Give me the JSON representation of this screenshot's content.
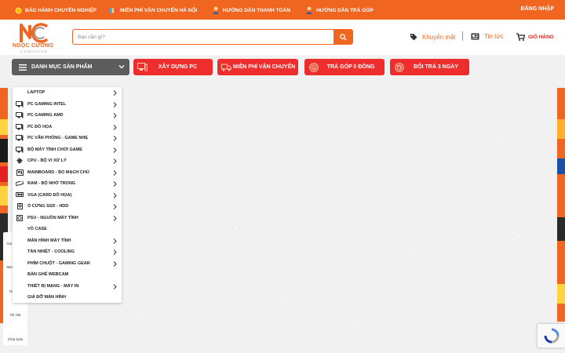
{
  "topbar": {
    "items": [
      {
        "label": "BẢO HÀNH CHUYÊN NGHIỆP",
        "icon": "coin-icon"
      },
      {
        "label": "MIỄN PHÍ VẬN CHUYỂN HÀ NỘI",
        "icon": "flag-icon"
      },
      {
        "label": "HƯỚNG DẪN THANH TOÁN",
        "icon": "user-guide-icon"
      },
      {
        "label": "HƯỚNG DẪN TRẢ GÓP",
        "icon": "user-guide-icon"
      }
    ],
    "login_label": "ĐĂNG NHẬP"
  },
  "header": {
    "logo_text": "NGỌC CƯỜNG",
    "logo_sub": "COMPUTER",
    "search_placeholder": "Bạn cần gì?",
    "promo_link": "Khuyến mãi",
    "news_link": "Tin tức",
    "cart_label": "GIỎ HÀNG"
  },
  "nav": {
    "category_label": "DANH MỤC SẢN PHẨM",
    "promos": [
      {
        "label": "XÂY DỰNG PC",
        "icon": "pc-build-icon"
      },
      {
        "label": "MIỄN PHÍ VẬN CHUYỂN",
        "icon": "truck-icon"
      },
      {
        "label": "TRẢ GÓP 0 ĐỒNG",
        "icon": "percent-badge-icon"
      },
      {
        "label": "ĐỔI TRẢ 3 NGÀY",
        "icon": "return-badge-icon"
      }
    ]
  },
  "menu": {
    "items": [
      {
        "label": "LAPTOP",
        "icon": "",
        "arrow": true
      },
      {
        "label": "PC GAMING INTEL",
        "icon": "desktop-icon",
        "arrow": true
      },
      {
        "label": "PC GAMING AMD",
        "icon": "desktop-icon",
        "arrow": true
      },
      {
        "label": "PC ĐỒ HỌA",
        "icon": "desktop-icon",
        "arrow": true
      },
      {
        "label": "PC VĂN PHÒNG - GAME NHẸ",
        "icon": "desktop-icon",
        "arrow": true
      },
      {
        "label": "BỘ MÁY TÍNH CHƠI GAME",
        "icon": "desktop-icon",
        "arrow": true
      },
      {
        "label": "CPU - BỘ VI XỬ LÝ",
        "icon": "cpu-icon",
        "arrow": true
      },
      {
        "label": "MAINBOARD - BO MẠCH CHỦ",
        "icon": "mainboard-icon",
        "arrow": true
      },
      {
        "label": "RAM - BỘ NHỚ TRONG",
        "icon": "ram-icon",
        "arrow": true
      },
      {
        "label": "VGA (CARD ĐỒ HỌA)",
        "icon": "vga-icon",
        "arrow": true
      },
      {
        "label": "Ổ CỨNG SSD - HDD",
        "icon": "ssd-icon",
        "arrow": true
      },
      {
        "label": "PSU - NGUỒN MÁY TÍNH",
        "icon": "psu-icon",
        "arrow": true
      },
      {
        "label": "VỎ CASE",
        "icon": "",
        "arrow": false
      },
      {
        "label": "MÀN HÌNH MÁY TÍNH",
        "icon": "",
        "arrow": true
      },
      {
        "label": "TẢN NHIỆT - COOLING",
        "icon": "",
        "arrow": true
      },
      {
        "label": "PHÍM CHUỘT - GAMING GEAR",
        "icon": "",
        "arrow": true
      },
      {
        "label": "BÀN GHẾ WEBCAM",
        "icon": "",
        "arrow": false
      },
      {
        "label": "THIẾT BỊ MẠNG - MÁY IN",
        "icon": "",
        "arrow": true
      },
      {
        "label": "GIÁ ĐỠ MÀN HÌNH",
        "icon": "",
        "arrow": false
      }
    ]
  },
  "social": {
    "items": [
      {
        "label": "Gọi Hotline"
      },
      {
        "label": "Messenger"
      },
      {
        "label": "Youtube"
      },
      {
        "label": "Tik Tok"
      },
      {
        "label": "Chat Zalo"
      }
    ]
  },
  "colors": {
    "brand": "#f0651f",
    "promo_red": "#ee2d2d",
    "category_bg": "#5d5d5d"
  }
}
